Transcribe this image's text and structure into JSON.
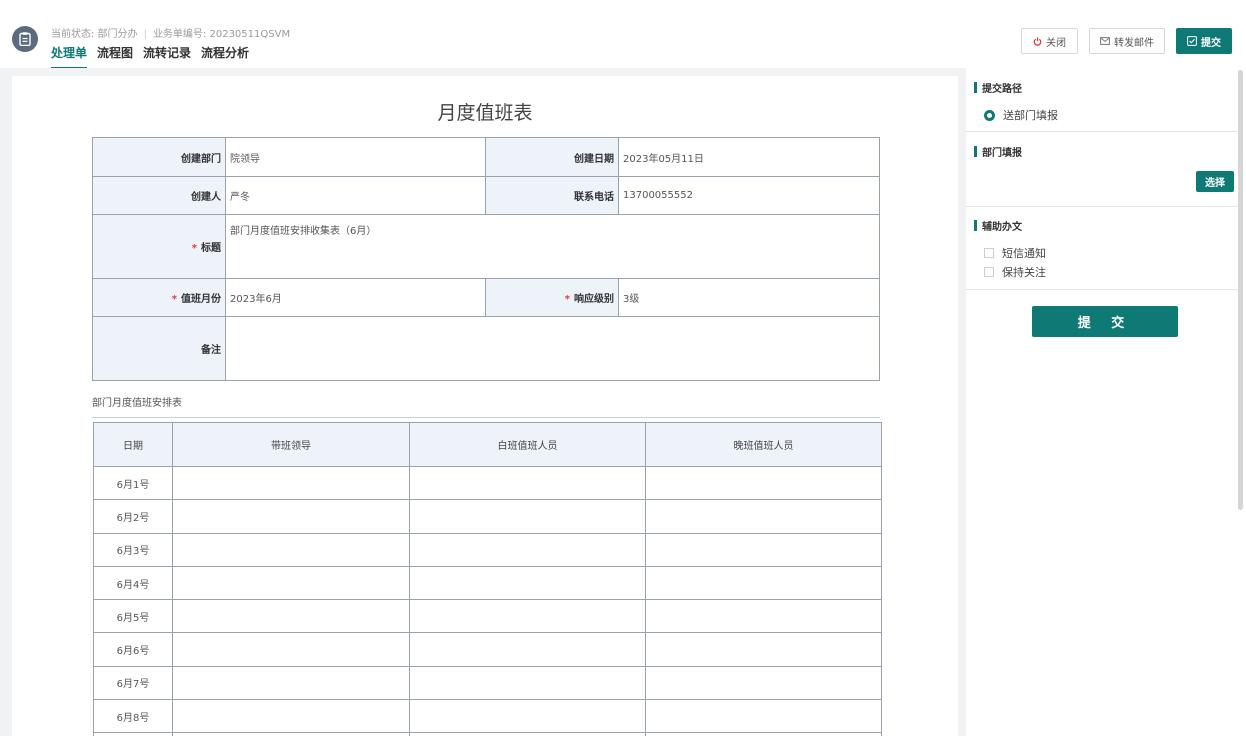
{
  "header": {
    "status_label": "当前状态: 部门分办",
    "business_no": "业务单编号: 20230511QSVM",
    "tabs": [
      "处理单",
      "流程图",
      "流转记录",
      "流程分析"
    ],
    "buttons": {
      "close": "关闭",
      "forward": "转发邮件",
      "submit": "提交"
    }
  },
  "form": {
    "title": "月度值班表",
    "fields": {
      "create_dept_label": "创建部门",
      "create_dept_value": "院领导",
      "create_date_label": "创建日期",
      "create_date_value": "2023年05月11日",
      "creator_label": "创建人",
      "creator_value": "严冬",
      "phone_label": "联系电话",
      "phone_value": "13700055552",
      "title_label": "标题",
      "title_value": "部门月度值班安排收集表（6月）",
      "month_label": "值班月份",
      "month_value": "2023年6月",
      "level_label": "响应级别",
      "level_value": "3级",
      "remark_label": "备注"
    },
    "required_mark": "*",
    "schedule": {
      "caption": "部门月度值班安排表",
      "columns": [
        "日期",
        "带班领导",
        "白班值班人员",
        "晚班值班人员"
      ],
      "rows": [
        "6月1号",
        "6月2号",
        "6月3号",
        "6月4号",
        "6月5号",
        "6月6号",
        "6月7号",
        "6月8号"
      ]
    }
  },
  "sidebar": {
    "path_title": "提交路径",
    "path_option": "送部门填报",
    "dept_title": "部门填报",
    "choose_button": "选择",
    "assist_title": "辅助办文",
    "options": [
      "短信通知",
      "保持关注"
    ],
    "submit_button": "提 交"
  },
  "colors": {
    "accent": "#0f7a75",
    "label_bg": "#eef3fa",
    "required": "#e23a3a"
  }
}
